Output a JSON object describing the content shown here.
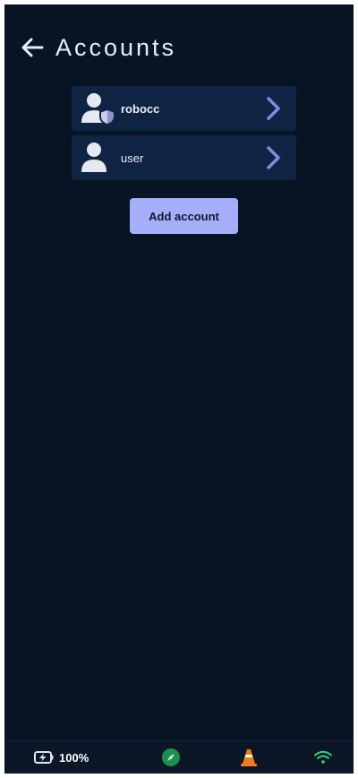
{
  "header": {
    "title": "Accounts",
    "back_icon": "arrow-left-icon"
  },
  "accounts": [
    {
      "name": "robocc",
      "icon": "user-shield-icon",
      "role": "admin",
      "chevron_icon": "chevron-right-icon"
    },
    {
      "name": "user",
      "icon": "user-icon",
      "role": "user",
      "chevron_icon": "chevron-right-icon"
    }
  ],
  "actions": {
    "add_account_label": "Add account"
  },
  "status_bar": {
    "battery_percent": "100%",
    "battery_icon": "battery-charging-icon",
    "compass_icon": "compass-icon",
    "cone_icon": "traffic-cone-icon",
    "wifi_icon": "wifi-icon"
  },
  "colors": {
    "background": "#081424",
    "row_background": "#0f2342",
    "accent": "#a5aef8",
    "chevron": "#7f8de0",
    "compass": "#1f8f4e",
    "cone": "#f07c1f",
    "wifi": "#3dd07a"
  }
}
